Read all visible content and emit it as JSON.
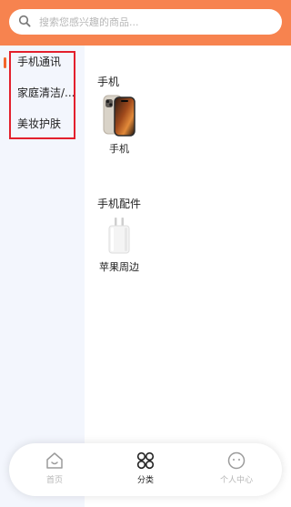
{
  "search": {
    "placeholder": "搜索您感兴趣的商品..."
  },
  "sidebar": {
    "items": [
      {
        "label": "手机通讯"
      },
      {
        "label": "家庭清洁/..."
      },
      {
        "label": "美妆护肤"
      }
    ]
  },
  "sections": [
    {
      "title": "手机",
      "products": [
        {
          "label": "手机"
        }
      ]
    },
    {
      "title": "手机配件",
      "products": [
        {
          "label": "苹果周边"
        }
      ]
    }
  ],
  "tabbar": {
    "items": [
      {
        "label": "首页",
        "icon": "home-icon"
      },
      {
        "label": "分类",
        "icon": "category-icon"
      },
      {
        "label": "个人中心",
        "icon": "profile-icon"
      }
    ]
  },
  "colors": {
    "header": "#f7834f",
    "accent": "#f2652b",
    "highlight": "#e3202d",
    "sidebar": "#f3f6fd"
  }
}
